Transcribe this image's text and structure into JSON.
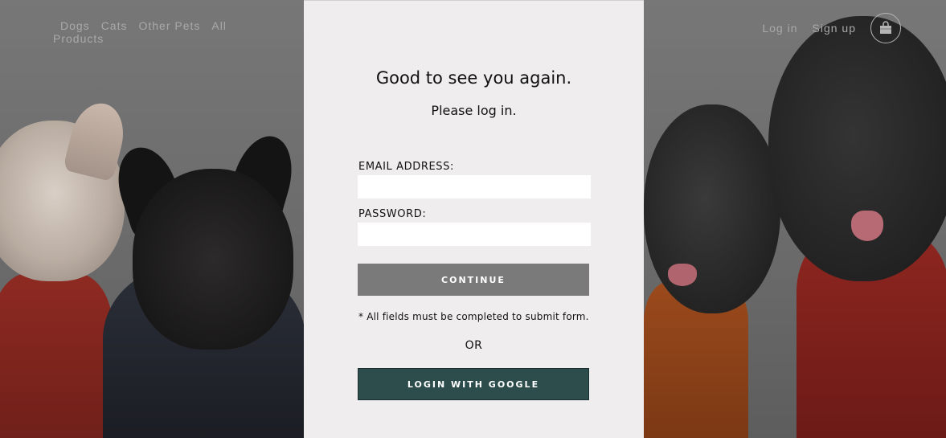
{
  "header": {
    "nav": [
      "Dogs",
      "Cats",
      "Other Pets",
      "All Products"
    ],
    "login": "Log in",
    "signup": "Sign up",
    "cart_icon": "shopping-bag-icon"
  },
  "login_form": {
    "title": "Good to see you again.",
    "subtitle": "Please log in.",
    "email_label": "EMAIL ADDRESS:",
    "email_value": "",
    "password_label": "PASSWORD:",
    "password_value": "",
    "continue_label": "CONTINUE",
    "note": "* All fields must be completed to submit form.",
    "or": "OR",
    "google_label": "LOGIN WITH GOOGLE"
  },
  "colors": {
    "modal_bg": "#efedee",
    "continue_btn": "#7a7a7a",
    "google_btn": "#2d4d4d"
  }
}
